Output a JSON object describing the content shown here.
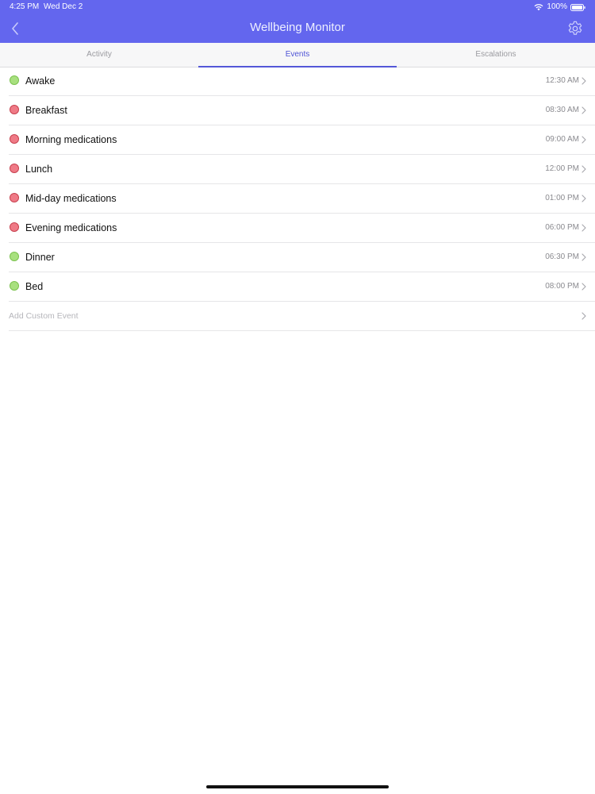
{
  "status_bar": {
    "time": "4:25 PM",
    "date": "Wed Dec 2",
    "battery": "100%"
  },
  "nav": {
    "title": "Wellbeing Monitor"
  },
  "tabs": [
    {
      "label": "Activity",
      "active": false
    },
    {
      "label": "Events",
      "active": true
    },
    {
      "label": "Escalations",
      "active": false
    }
  ],
  "events": [
    {
      "name": "Awake",
      "time": "12:30 AM",
      "status": "green"
    },
    {
      "name": "Breakfast",
      "time": "08:30 AM",
      "status": "red"
    },
    {
      "name": "Morning medications",
      "time": "09:00 AM",
      "status": "red"
    },
    {
      "name": "Lunch",
      "time": "12:00 PM",
      "status": "red"
    },
    {
      "name": "Mid-day medications",
      "time": "01:00 PM",
      "status": "red"
    },
    {
      "name": "Evening medications",
      "time": "06:00 PM",
      "status": "red"
    },
    {
      "name": "Dinner",
      "time": "06:30 PM",
      "status": "green"
    },
    {
      "name": "Bed",
      "time": "08:00 PM",
      "status": "green"
    }
  ],
  "add_event": {
    "label": "Add Custom Event"
  },
  "colors": {
    "header": "#6366ee",
    "tab_active": "#4f54d6",
    "status_green_fill": "#a8e07f",
    "status_green_border": "#7cc24f",
    "status_red_fill": "#ef7a86",
    "status_red_border": "#c8414f"
  },
  "icons": {
    "back": "chevron-left-icon",
    "settings": "gear-icon",
    "row_chevron": "chevron-right-icon",
    "wifi": "wifi-icon",
    "battery": "battery-icon"
  }
}
